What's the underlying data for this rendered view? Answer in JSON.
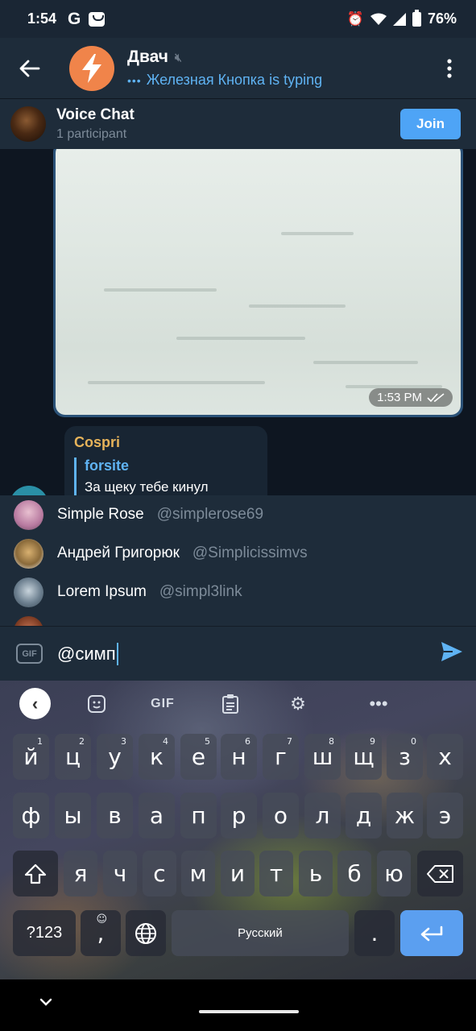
{
  "status_bar": {
    "time": "1:54",
    "battery": "76%",
    "icons": [
      "google-icon",
      "bag-icon",
      "alarm-icon",
      "wifi-icon",
      "signal-icon",
      "battery-icon"
    ]
  },
  "header": {
    "title": "Двач",
    "status": "Железная Кнопка is typing",
    "avatar_color": "#f0844a"
  },
  "voice_chat": {
    "title": "Voice Chat",
    "participants": "1 participant",
    "join_label": "Join"
  },
  "messages": {
    "media_time": "1:53 PM",
    "reply": {
      "author": "Cospri",
      "quoted_name": "forsite",
      "text": "За щеку тебе кинул"
    }
  },
  "mentions": [
    {
      "name": "Simple Rose",
      "username": "@simplerose69",
      "avatar_color": "#b87aa0"
    },
    {
      "name": "Андрей Григорюк",
      "username": "@Simplicissimvs",
      "avatar_color": "#8a6a3a"
    },
    {
      "name": "Lorem Ipsum",
      "username": "@simpl3link",
      "avatar_color": "#6d8090"
    }
  ],
  "input": {
    "value": "@симп"
  },
  "keyboard": {
    "row1": [
      "й",
      "ц",
      "у",
      "к",
      "е",
      "н",
      "г",
      "ш",
      "щ",
      "з",
      "х"
    ],
    "row1_hints": [
      "1",
      "2",
      "3",
      "4",
      "5",
      "6",
      "7",
      "8",
      "9",
      "0",
      ""
    ],
    "row2": [
      "ф",
      "ы",
      "в",
      "а",
      "п",
      "р",
      "о",
      "л",
      "д",
      "ж",
      "э"
    ],
    "row3": [
      "я",
      "ч",
      "с",
      "м",
      "и",
      "т",
      "ь",
      "б",
      "ю"
    ],
    "sym_label": "?123",
    "comma": ",",
    "space_label": "Русский",
    "period": "."
  },
  "colors": {
    "accent": "#5fb3f3",
    "join_button": "#4ea4f6",
    "reply_author": "#e6b35a",
    "bubble_out": "#2b5278",
    "bubble_in": "#182533",
    "chat_bg": "#0e1621"
  }
}
